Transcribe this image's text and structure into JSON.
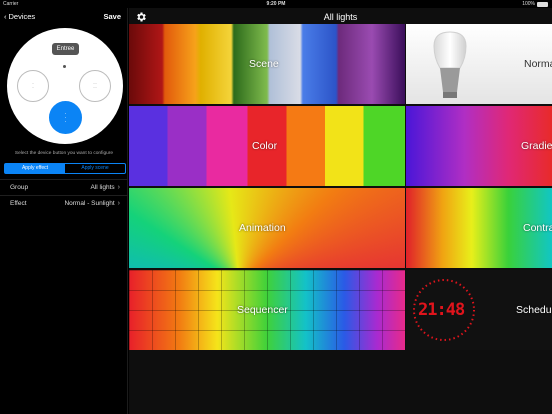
{
  "statusbar": {
    "carrier": "Carrier",
    "time": "9:20 PM",
    "battery": "100%"
  },
  "left": {
    "back_label": "Devices",
    "save_label": "Save",
    "remote": {
      "room_label": "Entree"
    },
    "hint": "Select the device button you want to configure",
    "segment": {
      "apply_effect": "Apply effect",
      "apply_scene": "Apply scene"
    },
    "rows": [
      {
        "key": "Group",
        "value": "All lights"
      },
      {
        "key": "Effect",
        "value": "Normal - Sunlight"
      }
    ]
  },
  "main": {
    "title": "All lights",
    "tiles": [
      {
        "label": "Scene"
      },
      {
        "label": "Normal"
      },
      {
        "label": "Color"
      },
      {
        "label": "Gradient"
      },
      {
        "label": "Animation"
      },
      {
        "label": "Contrast"
      },
      {
        "label": "Sequencer"
      },
      {
        "label": "Schedule"
      }
    ],
    "clock_digits": "21:48"
  },
  "colors": {
    "accent": "#0b84f5",
    "clock_red": "#e0141c"
  },
  "icons": [
    "chevron-left-icon",
    "gear-icon",
    "chevron-right-icon",
    "battery-icon",
    "wifi-icon"
  ]
}
